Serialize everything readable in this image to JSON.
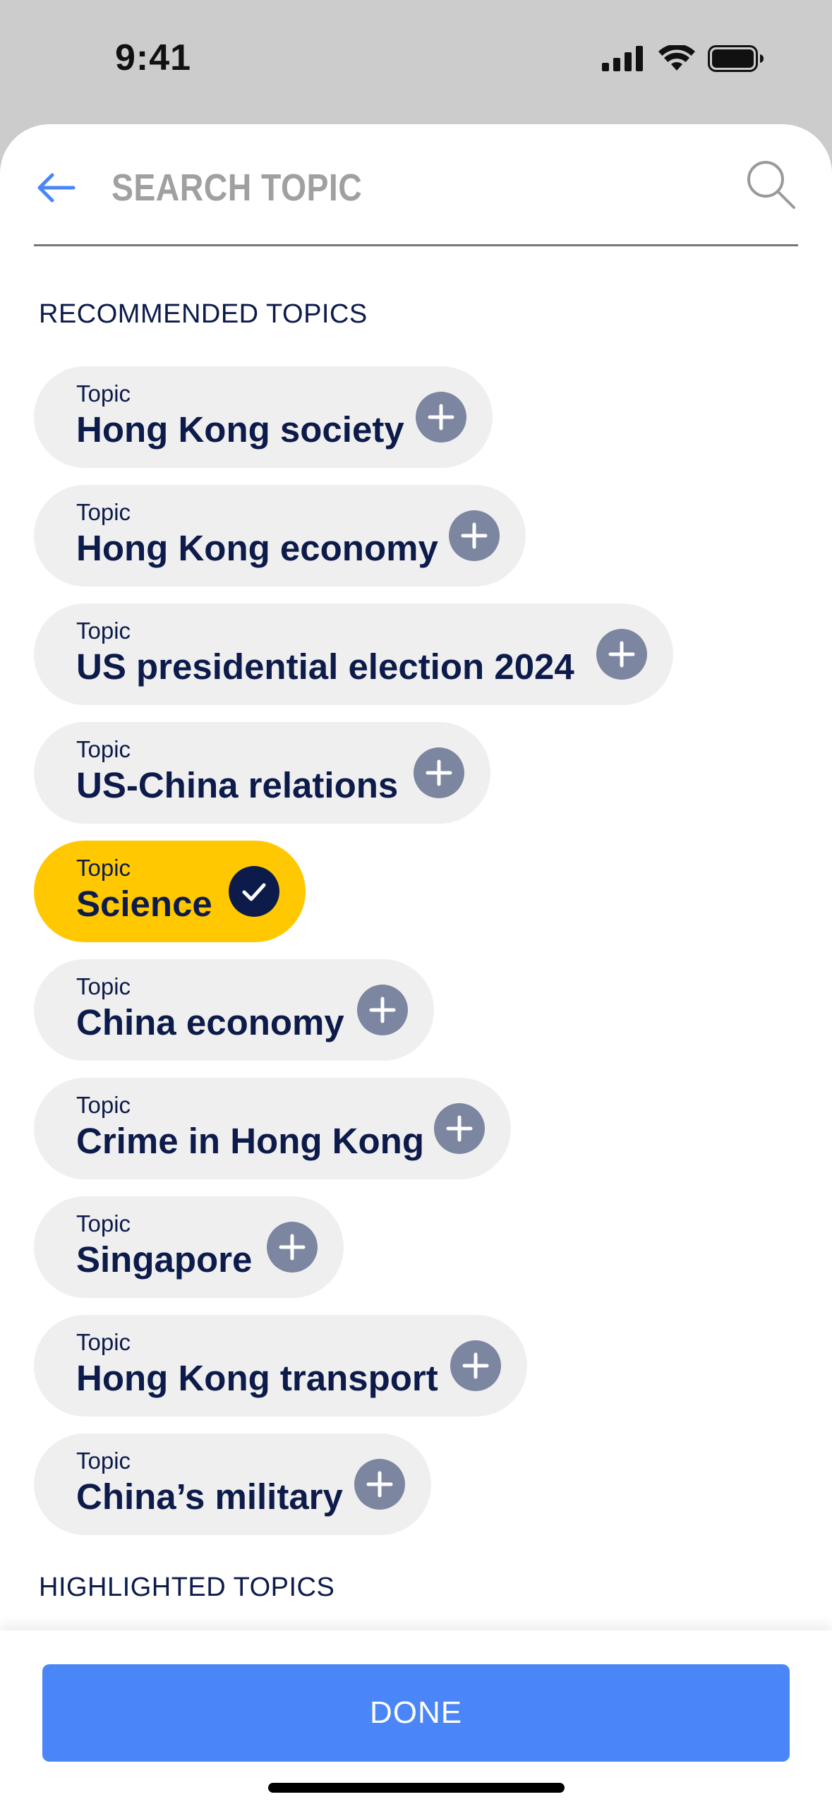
{
  "status_bar": {
    "time": "9:41"
  },
  "search": {
    "placeholder": "SEARCH TOPIC"
  },
  "sections": {
    "recommended_title": "RECOMMENDED TOPICS",
    "highlighted_title": "HIGHLIGHTED TOPICS"
  },
  "topics": [
    {
      "label": "Topic",
      "name": "Hong Kong society",
      "selected": false
    },
    {
      "label": "Topic",
      "name": "Hong Kong economy",
      "selected": false
    },
    {
      "label": "Topic",
      "name": "US presidential election 2024",
      "selected": false
    },
    {
      "label": "Topic",
      "name": "US-China relations",
      "selected": false
    },
    {
      "label": "Topic",
      "name": "Science",
      "selected": true
    },
    {
      "label": "Topic",
      "name": "China economy",
      "selected": false
    },
    {
      "label": "Topic",
      "name": "Crime in Hong Kong",
      "selected": false
    },
    {
      "label": "Topic",
      "name": "Singapore",
      "selected": false
    },
    {
      "label": "Topic",
      "name": "Hong Kong transport",
      "selected": false
    },
    {
      "label": "Topic",
      "name": "China’s military",
      "selected": false
    }
  ],
  "footer": {
    "done_label": "DONE"
  },
  "colors": {
    "accent": "#4a86f7",
    "navy": "#0d1b4b",
    "selected_chip": "#ffc800",
    "chip": "#efefef",
    "add_button": "#7d86a0"
  },
  "icons": {
    "back": "arrow-left-icon",
    "search": "magnifier-icon",
    "add": "plus-icon",
    "selected": "check-icon"
  }
}
